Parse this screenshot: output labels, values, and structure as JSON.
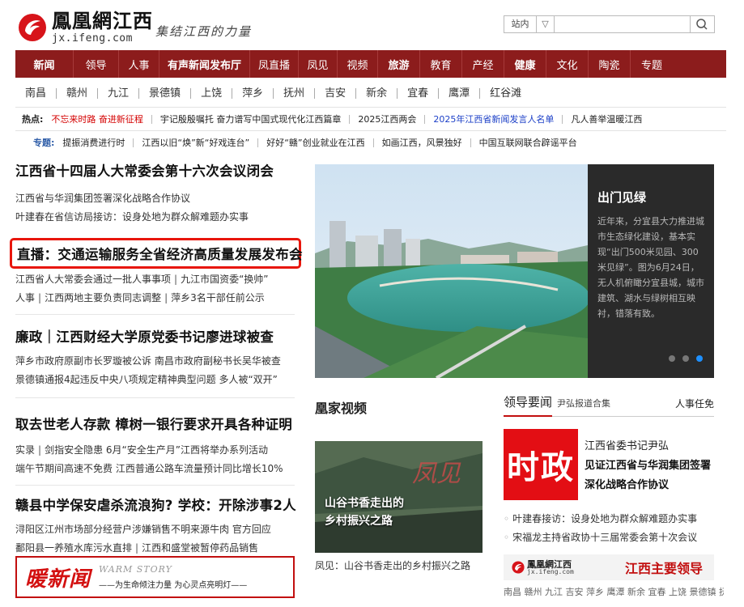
{
  "header": {
    "logo_cn": "鳳凰網江西",
    "logo_en": "jx.ifeng.com",
    "slogan": "集结江西的力量",
    "search_scope": "站内",
    "search_caret": "▽",
    "search_placeholder": ""
  },
  "nav": {
    "items": [
      {
        "label": "新闻",
        "bold": true
      },
      {
        "label": "领导",
        "bold": false
      },
      {
        "label": "人事",
        "bold": false
      },
      {
        "label": "有声新闻发布厅",
        "bold": true
      },
      {
        "label": "凤直播",
        "bold": false
      },
      {
        "label": "凤见",
        "bold": false
      },
      {
        "label": "视频",
        "bold": false
      },
      {
        "label": "旅游",
        "bold": true
      },
      {
        "label": "教育",
        "bold": false
      },
      {
        "label": "产经",
        "bold": false
      },
      {
        "label": "健康",
        "bold": true
      },
      {
        "label": "文化",
        "bold": false
      },
      {
        "label": "陶瓷",
        "bold": false
      },
      {
        "label": "专题",
        "bold": false
      }
    ]
  },
  "cities": [
    "南昌",
    "赣州",
    "九江",
    "景德镇",
    "上饶",
    "萍乡",
    "抚州",
    "吉安",
    "新余",
    "宜春",
    "鹰潭",
    "红谷滩"
  ],
  "hot": {
    "label": "热点:",
    "items": [
      {
        "text": "不忘来时路 奋进新征程",
        "color": "red"
      },
      {
        "text": "宇记殷殷嘱托 奋力谱写中国式现代化江西篇章",
        "color": "normal"
      },
      {
        "text": "2025江西两会",
        "color": "normal"
      },
      {
        "text": "2025年江西省新闻发言人名单",
        "color": "blue"
      },
      {
        "text": "凡人善举温暖江西",
        "color": "normal"
      }
    ]
  },
  "topics": {
    "label": "专题:",
    "items": [
      "提振消费进行时",
      "江西以旧“焕”新“好戏连台”",
      "好好“赣”创业就业在江西",
      "如画江西，风景独好",
      "中国互联网联合辟谣平台"
    ]
  },
  "left": {
    "h1": "江西省十四届人大常委会第十六次会议闭会",
    "h1_sub1": "江西省与华润集团签署深化战略合作协议",
    "h1_sub2": "叶建春在省信访局接访：设身处地为群众解难题办实事",
    "h2": "直播：交通运输服务全省经济高质量发展发布会",
    "h2_sub1a": "江西省人大常委会通过一批人事事项",
    "h2_sub1b": "九江市国资委“换帅”",
    "h2_sub2a": "人事",
    "h2_sub2b": "江西两地主要负责同志调整",
    "h2_sub2c": "萍乡3名干部任前公示",
    "h3": "廉政｜江西财经大学原党委书记廖进球被查",
    "h3_sub1": "萍乡市政府原副市长罗璇被公诉  南昌市政府副秘书长吴华被查",
    "h3_sub2": "景德镇通报4起违反中央八项规定精神典型问题  多人被“双开”",
    "h4": "取去世老人存款 樟树一银行要求开具各种证明",
    "h4_sub1a": "实录",
    "h4_sub1b": "剑指安全隐患 6月“安全生产月”江西将举办系列活动",
    "h4_sub2": "端午节期间高速不免费  江西普通公路车流量预计同比增长10%",
    "h5": "赣县中学保安虐杀流浪狗? 学校：开除涉事2人",
    "h5_sub1": "浔阳区江州市场部分经营户涉嫌销售不明来源牛肉  官方回应",
    "h5_sub2a": "鄱阳县一养殖水库污水直排",
    "h5_sub2b": "江西和盛堂被暂停药品销售",
    "separator": "|"
  },
  "warm": {
    "title": "暖新闻",
    "en": "WARM STORY",
    "slogan": "——为生命倾注力量 为心灵点亮明灯——"
  },
  "slide": {
    "title": "出门见绿",
    "desc": "近年来，分宜县大力推进城市生态绿化建设，基本实现“出门500米见园、300米见绿”。图为6月24日，无人机俯瞰分宜县城，城市建筑、湖水与绿树相互映衬，错落有致。",
    "active_dot": 2
  },
  "video": {
    "section_title": "凰家视频",
    "overlay_line1": "山谷书香走出的",
    "overlay_line2": "乡村振兴之路",
    "caption": "凤见：山谷书香走出的乡村振兴之路"
  },
  "right": {
    "tab_active": "领导要闻",
    "tab_sub": "尹弘报道合集",
    "tab_right": "人事任免",
    "shizheng_badge": "时政",
    "shizheng_line1": "江西省委书记尹弘",
    "shizheng_line2": "见证江西省与华润集团签署深化战略合作协议",
    "news": [
      "叶建春接访：设身处地为群众解难题办实事",
      "宋福龙主持省政协十三届常委会第十次会议"
    ],
    "bullet": "◦",
    "leaders_logo": "鳳凰網江西",
    "leaders_logo_en": "jx.ifeng.com",
    "leaders_title": "江西主要领导",
    "cities": "南昌 赣州 九江 吉安 萍乡 鹰潭 新余 宜春 上饶 景德镇 抚州"
  },
  "colors": {
    "nav_bg": "#8c1c1c",
    "highlight": "#e8160c",
    "brand_red": "#c20f0f",
    "link_blue": "#1b3fc7"
  }
}
